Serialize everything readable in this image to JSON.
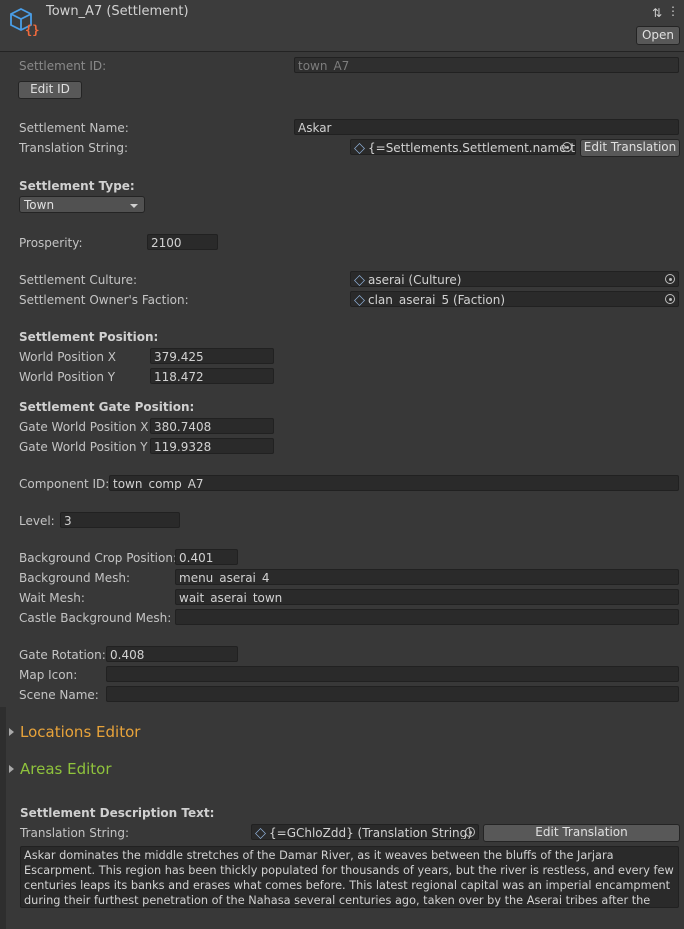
{
  "header": {
    "title": "Town_A7 (Settlement)",
    "open_label": "Open",
    "icon": "script-object-icon",
    "icon_colors": {
      "cube": "#4a9ee8",
      "braces": "#f06a3c"
    }
  },
  "settlement_id": {
    "label": "Settlement ID:",
    "value": "town_A7",
    "edit_label": "Edit ID"
  },
  "name": {
    "label": "Settlement Name:",
    "value": "Askar"
  },
  "translation": {
    "label": "Translation String:",
    "value": "{=Settlements.Settlement.name.to",
    "edit_label": "Edit Translation"
  },
  "type": {
    "heading": "Settlement Type:",
    "selected": "Town"
  },
  "prosperity": {
    "label": "Prosperity:",
    "value": "2100"
  },
  "culture": {
    "label": "Settlement Culture:",
    "value": "aserai (Culture)"
  },
  "owner_faction": {
    "label": "Settlement Owner's Faction:",
    "value": "clan_aserai_5 (Faction)"
  },
  "position": {
    "heading": "Settlement Position:",
    "x_label": "World Position X",
    "x_value": "379.425",
    "y_label": "World Position Y",
    "y_value": "118.472"
  },
  "gate_position": {
    "heading": "Settlement Gate Position:",
    "x_label": "Gate World Position X",
    "x_value": "380.7408",
    "y_label": "Gate World Position Y",
    "y_value": "119.9328"
  },
  "component": {
    "label": "Component ID:",
    "value": "town_comp_A7"
  },
  "level": {
    "label": "Level:",
    "value": "3"
  },
  "background": {
    "crop_label": "Background Crop Position:",
    "crop_value": "0.401",
    "mesh_label": "Background Mesh:",
    "mesh_value": "menu_aserai_4",
    "wait_label": "Wait Mesh:",
    "wait_value": "wait_aserai_town",
    "castle_label": "Castle Background Mesh:",
    "castle_value": ""
  },
  "gate": {
    "rotation_label": "Gate Rotation:",
    "rotation_value": "0.408",
    "map_icon_label": "Map Icon:",
    "map_icon_value": "",
    "scene_label": "Scene Name:",
    "scene_value": ""
  },
  "foldouts": {
    "locations": "Locations Editor",
    "locations_color": "#e8a33a",
    "areas": "Areas Editor",
    "areas_color": "#8fc33c"
  },
  "description": {
    "heading": "Settlement Description Text:",
    "translation_label": "Translation String:",
    "translation_value": "{=GChloZdd} (Translation String)",
    "edit_label": "Edit Translation",
    "text": "Askar dominates the middle stretches of the Damar River, as it weaves between the bluffs of the Jarjara Escarpment. This region has been thickly populated for thousands of years, but the river is restless, and every few centuries leaps its banks and erases what comes before. This latest regional capital was an imperial encampment  during their furthest penetration of the Nahasa several centuries ago, taken over by the Aserai tribes after the legions withdrew."
  }
}
